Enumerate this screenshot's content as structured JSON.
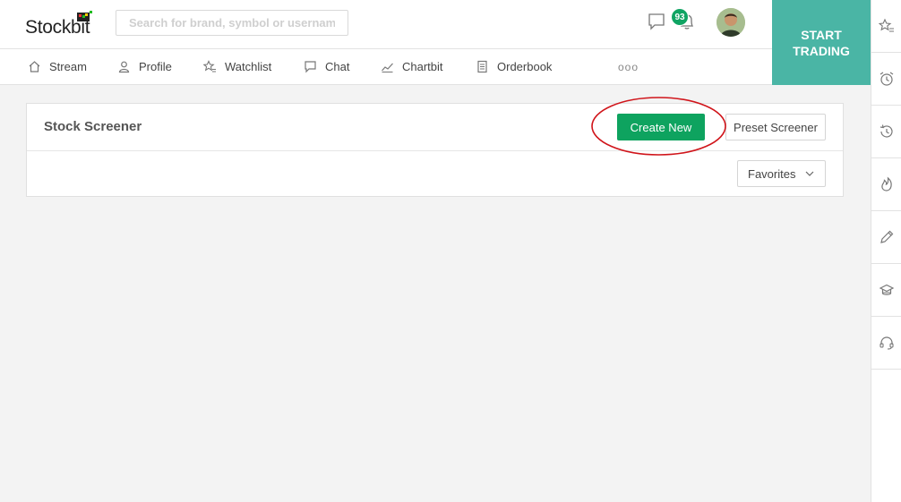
{
  "header": {
    "logo_text": "Stockbit",
    "search_placeholder": "Search for brand, symbol or username",
    "notification_count": "93",
    "start_trading": "START\nTRADING"
  },
  "nav": {
    "items": [
      {
        "label": "Stream",
        "icon": "home-icon"
      },
      {
        "label": "Profile",
        "icon": "user-icon"
      },
      {
        "label": "Watchlist",
        "icon": "star-list-icon"
      },
      {
        "label": "Chat",
        "icon": "chat-icon"
      },
      {
        "label": "Chartbit",
        "icon": "chart-line-icon"
      },
      {
        "label": "Orderbook",
        "icon": "book-icon"
      }
    ],
    "more": "ooo"
  },
  "card": {
    "title": "Stock Screener",
    "create_new": "Create New",
    "preset_screener": "Preset Screener",
    "favorites": "Favorites"
  },
  "sidebar_icons": [
    "star-list-icon",
    "alarm-icon",
    "history-icon",
    "fire-icon",
    "pencil-icon",
    "hat-icon",
    "headset-icon"
  ],
  "colors": {
    "brand_green": "#0ea35f",
    "teal": "#4ab5a5",
    "annotation_red": "#d0141a"
  }
}
